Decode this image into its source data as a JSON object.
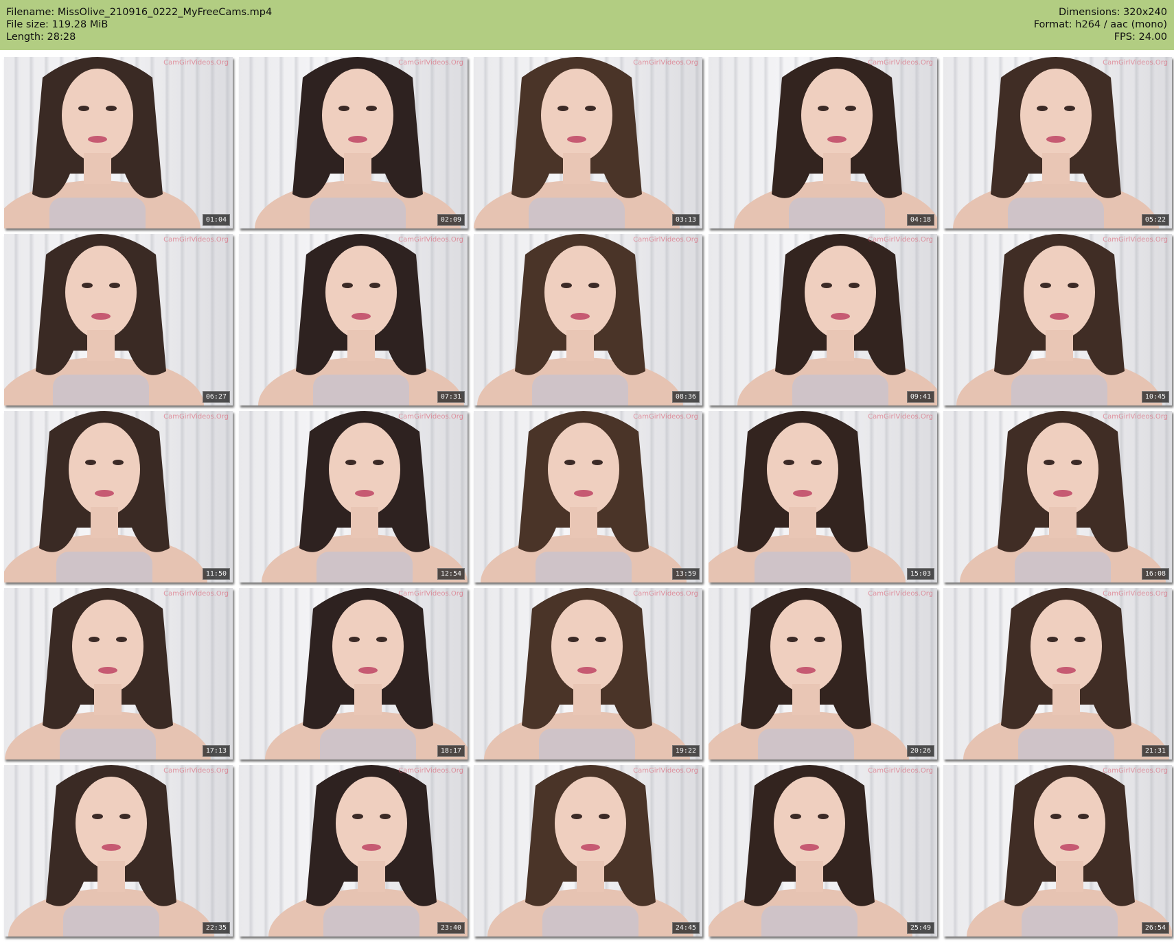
{
  "header": {
    "filename_line": "Filename: MissOlive_210916_0222_MyFreeCams.mp4",
    "filesize_line": "File size: 119.28 MiB",
    "length_line": "Length: 28:28",
    "dimensions_line": "Dimensions: 320x240",
    "format_line": "Format: h264 / aac (mono)",
    "fps_line": "FPS: 24.00",
    "background_color": "#b2cd82"
  },
  "watermark_text": "CamGirlVideos.Org",
  "frames": [
    {
      "timestamp": "01:04"
    },
    {
      "timestamp": "02:09"
    },
    {
      "timestamp": "03:13"
    },
    {
      "timestamp": "04:18"
    },
    {
      "timestamp": "05:22"
    },
    {
      "timestamp": "06:27"
    },
    {
      "timestamp": "07:31"
    },
    {
      "timestamp": "08:36"
    },
    {
      "timestamp": "09:41"
    },
    {
      "timestamp": "10:45"
    },
    {
      "timestamp": "11:50"
    },
    {
      "timestamp": "12:54"
    },
    {
      "timestamp": "13:59"
    },
    {
      "timestamp": "15:03"
    },
    {
      "timestamp": "16:08"
    },
    {
      "timestamp": "17:13"
    },
    {
      "timestamp": "18:17"
    },
    {
      "timestamp": "19:22"
    },
    {
      "timestamp": "20:26"
    },
    {
      "timestamp": "21:31"
    },
    {
      "timestamp": "22:35"
    },
    {
      "timestamp": "23:40"
    },
    {
      "timestamp": "24:45"
    },
    {
      "timestamp": "25:49"
    },
    {
      "timestamp": "26:54"
    }
  ]
}
